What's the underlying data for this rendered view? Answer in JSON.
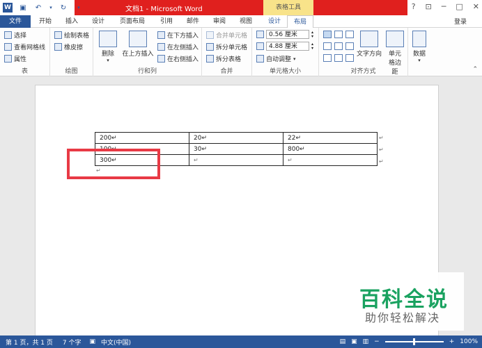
{
  "titlebar": {
    "title": "文档1 - Microsoft Word",
    "table_tools": "表格工具",
    "help": "?",
    "minimize": "─",
    "restore": "□",
    "close": "✕"
  },
  "tabs": [
    "文件",
    "开始",
    "插入",
    "设计",
    "页面布局",
    "引用",
    "邮件",
    "审阅",
    "视图",
    "设计",
    "布局"
  ],
  "login": "登录",
  "ribbon": {
    "table_group": {
      "select": "选择",
      "gridlines": "查看网格线",
      "properties": "属性",
      "label": "表"
    },
    "draw_group": {
      "draw_table": "绘制表格",
      "eraser": "橡皮擦",
      "label": "绘图"
    },
    "rows_group": {
      "delete": "删除",
      "insert_above": "在上方插入",
      "insert_below": "在下方插入",
      "insert_left": "在左侧插入",
      "insert_right": "在右侧插入",
      "label": "行和列"
    },
    "merge_group": {
      "merge_cells": "合并单元格",
      "split_cells": "拆分单元格",
      "split_table": "拆分表格",
      "label": "合并"
    },
    "size_group": {
      "height": "0.56 厘米",
      "width": "4.88 厘米",
      "autofit": "自动调整",
      "label": "单元格大小"
    },
    "align_group": {
      "text_direction": "文字方向",
      "cell_margins": "单元格边距",
      "label": "对齐方式"
    },
    "data_group": {
      "data": "数据"
    }
  },
  "table": {
    "rows": [
      [
        "200↵",
        "20↵",
        "22↵"
      ],
      [
        "100↵",
        "30↵",
        "800↵"
      ],
      [
        "300↵",
        "↵",
        "↵"
      ]
    ],
    "end_mark": "↵"
  },
  "watermark": {
    "title": "百科全说",
    "subtitle": "助你轻松解决"
  },
  "status": {
    "page": "第 1 页，共 1 页",
    "words": "7 个字",
    "lang": "中文(中国)",
    "zoom": "100%"
  }
}
